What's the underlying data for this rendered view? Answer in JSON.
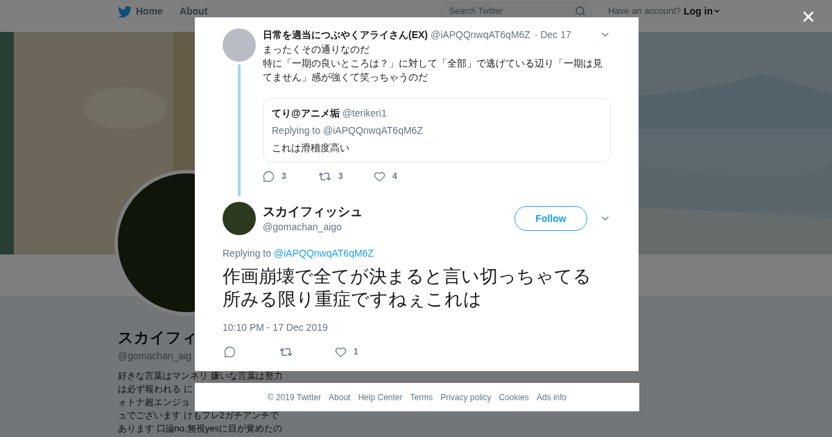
{
  "nav": {
    "items": [
      {
        "label": "Home"
      },
      {
        "label": "About"
      }
    ],
    "search": {
      "placeholder": "Search Twitter"
    },
    "account_prompt": "Have an account?",
    "login": "Log in"
  },
  "profile": {
    "name": "スカイフィ",
    "handle": "@gomachan_aig",
    "bio_lines": [
      "好きな言葉はマンネリ 嫌いな言葉は努力",
      "は必ず報われる に",
      "ォトナ超エンジョ",
      "ュでございます けもフレ2ガチアンチで",
      "あります 口論no,無視yesに目が覚めたの"
    ]
  },
  "modal": {
    "parent_tweet": {
      "name": "日常を適当につぶやくアライさん(EX)",
      "handle": "@iAPQQnwqAT6qM6Z",
      "date": "· Dec 17",
      "text_lines": [
        "まったくその通りなのだ",
        "特に「一期の良いところは？」に対して「全部」で逃げている辺り「一期は見てません」感が強くて笑っちゃうのだ"
      ],
      "quoted": {
        "name": "てり@アニメ垢",
        "handle": "@terikeri1",
        "replying_label": "Replying to",
        "replying_handle": "@iAPQQnwqAT6qM6Z",
        "text": "これは滑稽度高い"
      },
      "actions": [
        {
          "kind": "reply",
          "count": "3"
        },
        {
          "kind": "retweet",
          "count": "3"
        },
        {
          "kind": "like",
          "count": "4"
        }
      ]
    },
    "tweet": {
      "name": "スカイフィッシュ",
      "handle": "@gomachan_aigo",
      "follow": "Follow",
      "replying_label": "Replying to",
      "replying_handle": "@iAPQQnwqAT6qM6Z",
      "text": "作画崩壊で全てが決まると言い切っちゃてる所みる限り重症ですねぇこれは",
      "timestamp": "10:10 PM - 17 Dec 2019",
      "actions": [
        {
          "kind": "reply"
        },
        {
          "kind": "retweet"
        },
        {
          "kind": "like",
          "count": "1"
        }
      ]
    }
  },
  "footer": {
    "links": [
      "© 2019 Twitter",
      "About",
      "Help Center",
      "Terms",
      "Privacy policy",
      "Cookies",
      "Ads info"
    ]
  }
}
